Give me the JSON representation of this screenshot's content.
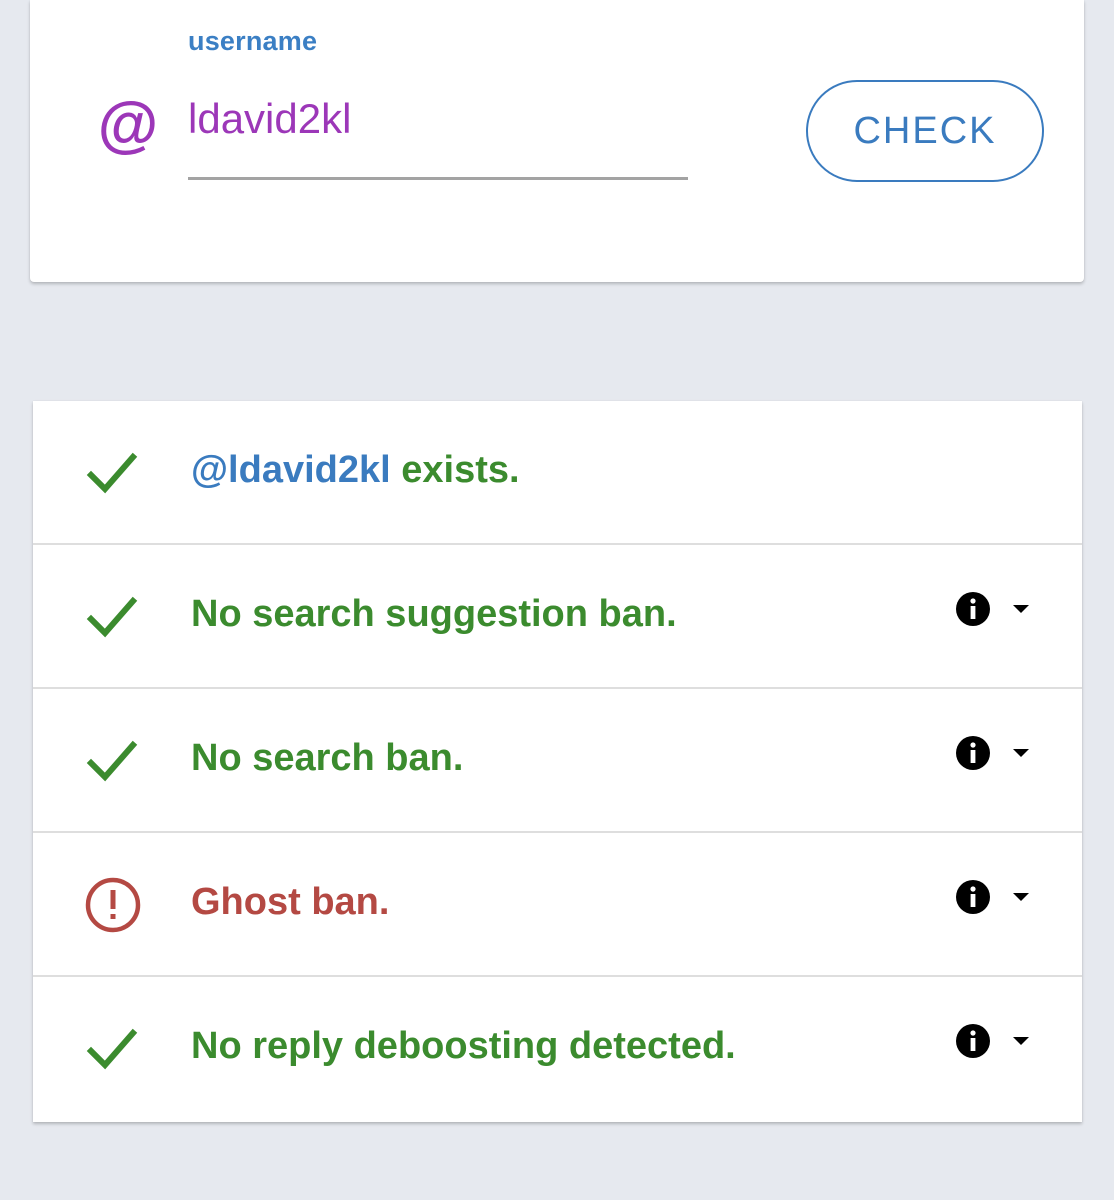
{
  "search": {
    "label": "username",
    "at_symbol": "@",
    "value": "ldavid2kl",
    "check_label": "CHECK"
  },
  "colors": {
    "accent_blue": "#3a7bbf",
    "at_purple": "#9c37b8",
    "ok_green": "#3b8b2e",
    "ban_red": "#b44943",
    "background": "#e6e9ef"
  },
  "results": [
    {
      "status": "ok",
      "icon": "check-icon",
      "handle": "@ldavid2kl",
      "text": " exists.",
      "has_details": false
    },
    {
      "status": "ok",
      "icon": "check-icon",
      "text": "No search suggestion ban.",
      "has_details": true
    },
    {
      "status": "ok",
      "icon": "check-icon",
      "text": "No search ban.",
      "has_details": true
    },
    {
      "status": "bad",
      "icon": "alert-circle-icon",
      "text": "Ghost ban.",
      "has_details": true
    },
    {
      "status": "ok",
      "icon": "check-icon",
      "text": "No reply deboosting detected.",
      "has_details": true
    }
  ]
}
